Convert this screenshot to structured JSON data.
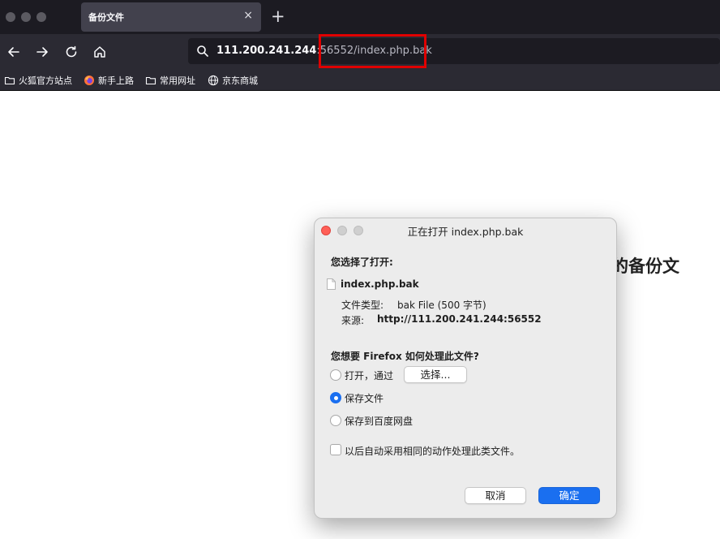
{
  "browser": {
    "tab": {
      "title": "备份文件",
      "close_glyph": "×"
    },
    "new_tab_glyph": "+",
    "url": {
      "host": "111.200.241.244",
      "rest": ":56552/index.php.bak"
    },
    "bookmarks": [
      {
        "label": "火狐官方站点",
        "icon": "folder-icon"
      },
      {
        "label": "新手上路",
        "icon": "firefox-icon"
      },
      {
        "label": "常用网址",
        "icon": "folder-icon"
      },
      {
        "label": "京东商城",
        "icon": "globe-icon"
      }
    ]
  },
  "page": {
    "heading_fragment": "的备份文"
  },
  "dialog": {
    "title": "正在打开 index.php.bak",
    "you_chose": "您选择了打开:",
    "file_name": "index.php.bak",
    "type_label": "文件类型:",
    "type_value": "bak File (500 字节)",
    "source_label": "来源:",
    "source_value": "http://111.200.241.244:56552",
    "question": "您想要 Firefox 如何处理此文件?",
    "option_open": "打开，通过",
    "choose_button": "选择...",
    "option_save": "保存文件",
    "option_baidu": "保存到百度网盘",
    "selected_option": "保存文件",
    "remember_label": "以后自动采用相同的动作处理此类文件。",
    "cancel_button": "取消",
    "ok_button": "确定"
  },
  "colors": {
    "highlight": "#e00000",
    "primary": "#1a6ff0",
    "close_light": "#ff5f57",
    "tab_bg": "#42414d",
    "toolbar_bg": "#2b2a33"
  }
}
